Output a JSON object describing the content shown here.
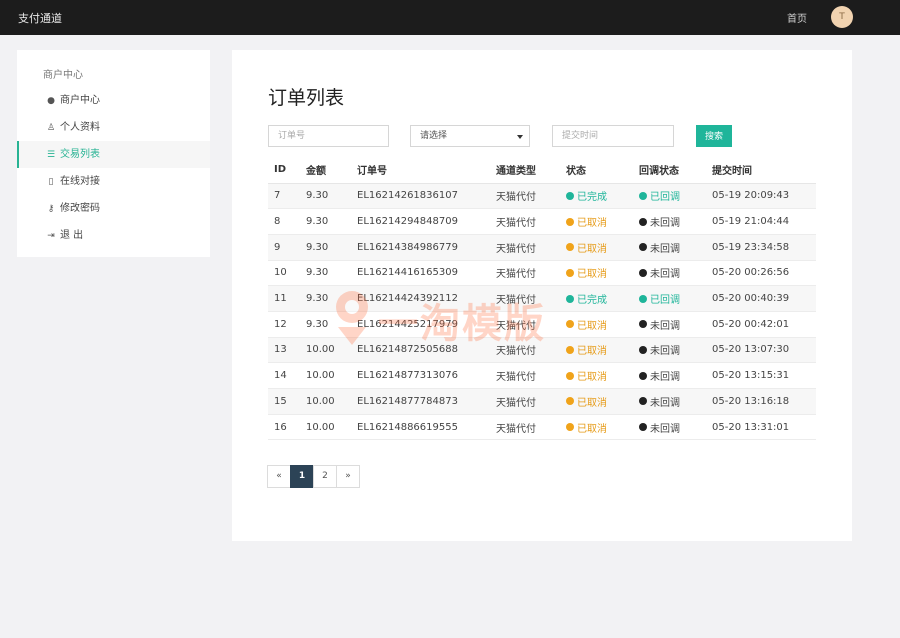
{
  "topbar": {
    "brand": "支付通道",
    "home": "首页",
    "avatar_initial": "T"
  },
  "sidebar": {
    "title": "商户中心",
    "items": [
      {
        "label": "商户中心",
        "icon": "user-circle-icon",
        "active": false
      },
      {
        "label": "个人资料",
        "icon": "user-icon",
        "active": false
      },
      {
        "label": "交易列表",
        "icon": "list-icon",
        "active": true
      },
      {
        "label": "在线对接",
        "icon": "file-icon",
        "active": false
      },
      {
        "label": "修改密码",
        "icon": "key-icon",
        "active": false
      },
      {
        "label": "退 出",
        "icon": "sign-out-icon",
        "active": false
      }
    ]
  },
  "main": {
    "title": "订单列表",
    "search": {
      "order_placeholder": "订单号",
      "select_value": "请选择",
      "time_placeholder": "提交时间",
      "button": "搜索"
    },
    "table": {
      "headers": [
        "ID",
        "金额",
        "订单号",
        "通道类型",
        "状态",
        "回调状态",
        "提交时间"
      ],
      "rows": [
        [
          "7",
          "9.30",
          "EL16214261836107",
          "天猫代付",
          "已完成",
          "已回调",
          "05-19 20:09:43"
        ],
        [
          "8",
          "9.30",
          "EL16214294848709",
          "天猫代付",
          "已取消",
          "未回调",
          "05-19 21:04:44"
        ],
        [
          "9",
          "9.30",
          "EL16214384986779",
          "天猫代付",
          "已取消",
          "未回调",
          "05-19 23:34:58"
        ],
        [
          "10",
          "9.30",
          "EL16214416165309",
          "天猫代付",
          "已取消",
          "未回调",
          "05-20 00:26:56"
        ],
        [
          "11",
          "9.30",
          "EL16214424392112",
          "天猫代付",
          "已完成",
          "已回调",
          "05-20 00:40:39"
        ],
        [
          "12",
          "9.30",
          "EL16214425217979",
          "天猫代付",
          "已取消",
          "未回调",
          "05-20 00:42:01"
        ],
        [
          "13",
          "10.00",
          "EL16214872505688",
          "天猫代付",
          "已取消",
          "未回调",
          "05-20 13:07:30"
        ],
        [
          "14",
          "10.00",
          "EL16214877313076",
          "天猫代付",
          "已取消",
          "未回调",
          "05-20 13:15:31"
        ],
        [
          "15",
          "10.00",
          "EL16214877784873",
          "天猫代付",
          "已取消",
          "未回调",
          "05-20 13:16:18"
        ],
        [
          "16",
          "10.00",
          "EL16214886619555",
          "天猫代付",
          "已取消",
          "未回调",
          "05-20 13:31:01"
        ]
      ]
    },
    "pagination": {
      "prev": "«",
      "pages": [
        "1",
        "2"
      ],
      "current": "1",
      "next": "»"
    }
  },
  "watermark": {
    "text": "一淘模版"
  },
  "colors": {
    "accent": "#1fb59a",
    "cancelled": "#f0a31a",
    "pending": "#222222",
    "topbar": "#1c1c1c",
    "page_active": "#2c4356"
  }
}
